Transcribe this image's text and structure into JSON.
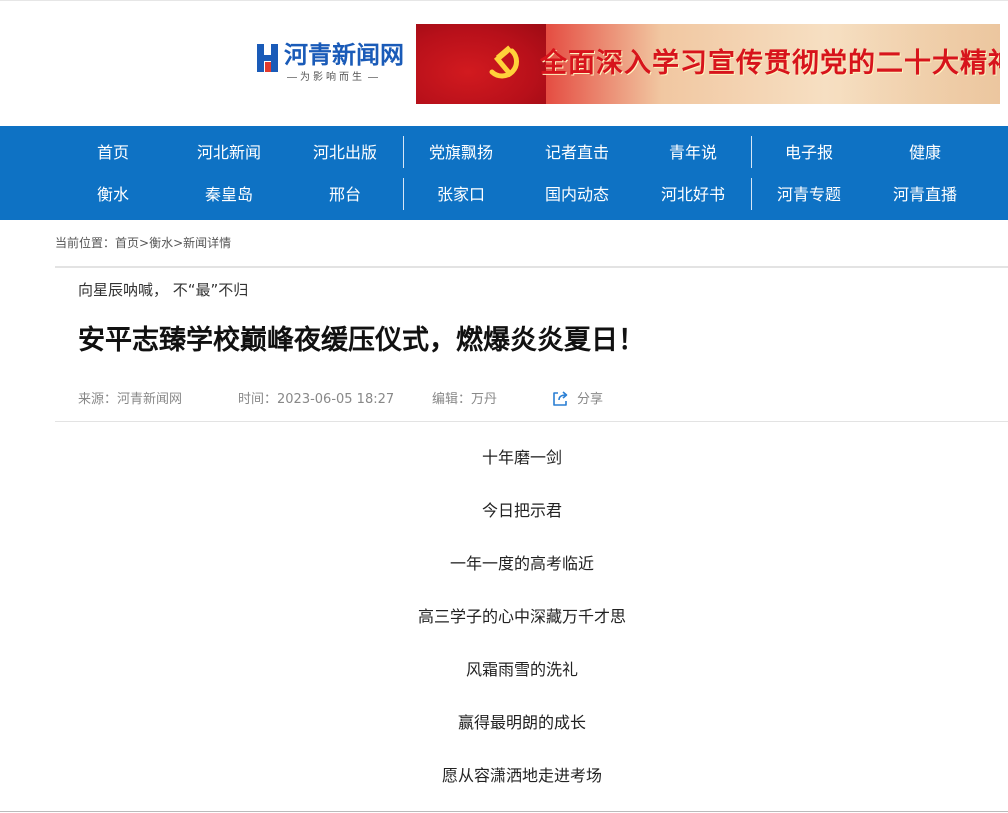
{
  "header": {
    "logo_title": "河青新闻网",
    "logo_slogan": "为影响而生",
    "banner_text": "全面深入学习宣传贯彻党的二十大精神",
    "colors": {
      "brand_blue": "#1a5bb8",
      "banner_red": "#d7141c"
    }
  },
  "nav": {
    "row1": [
      "首页",
      "河北新闻",
      "河北出版",
      "党旗飘扬",
      "记者直击",
      "青年说",
      "电子报",
      "健康"
    ],
    "row2": [
      "衡水",
      "秦皇岛",
      "邢台",
      "张家口",
      "国内动态",
      "河北好书",
      "河青专题",
      "河青直播"
    ],
    "color": "#0e72c4"
  },
  "breadcrumb": {
    "prefix": "当前位置：",
    "home": "首页",
    "sep1": ">",
    "section": "衡水",
    "sep2": ">",
    "current": "新闻详情"
  },
  "article": {
    "subtitle": "向星辰呐喊， 不“最”不归",
    "title": "安平志臻学校巅峰夜缓压仪式，燃爆炎炎夏日！",
    "meta": {
      "source": "来源：河青新闻网",
      "time": "时间：2023-06-05 18:27",
      "editor": "编辑：万丹",
      "share_label": "分享",
      "share_icon": "share-icon"
    },
    "paragraphs": [
      "十年磨一剑",
      "今日把示君",
      "一年一度的高考临近",
      "高三学子的心中深藏万千才思",
      "风霜雨雪的洗礼",
      "赢得最明朗的成长",
      "愿从容潇洒地走进考场"
    ]
  }
}
